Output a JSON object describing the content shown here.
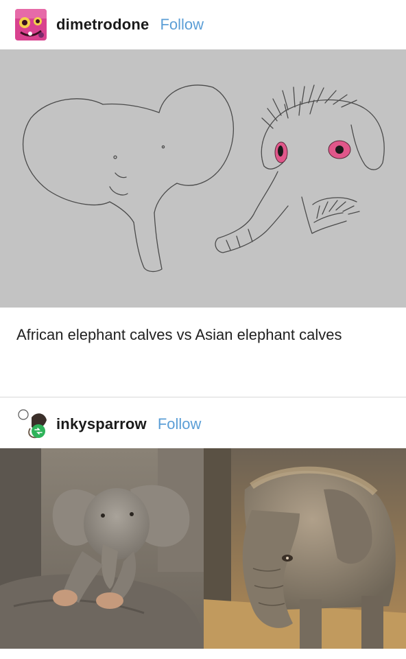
{
  "post1": {
    "username": "dimetrodone",
    "follow_label": "Follow",
    "caption": "African elephant calves vs Asian elephant calves"
  },
  "post2": {
    "username": "inkysparrow",
    "follow_label": "Follow"
  },
  "colors": {
    "follow": "#5b9ed6",
    "drawing_bg": "#c3c3c3",
    "eye_pink": "#e0578a",
    "avatar1": "#d9428f"
  }
}
